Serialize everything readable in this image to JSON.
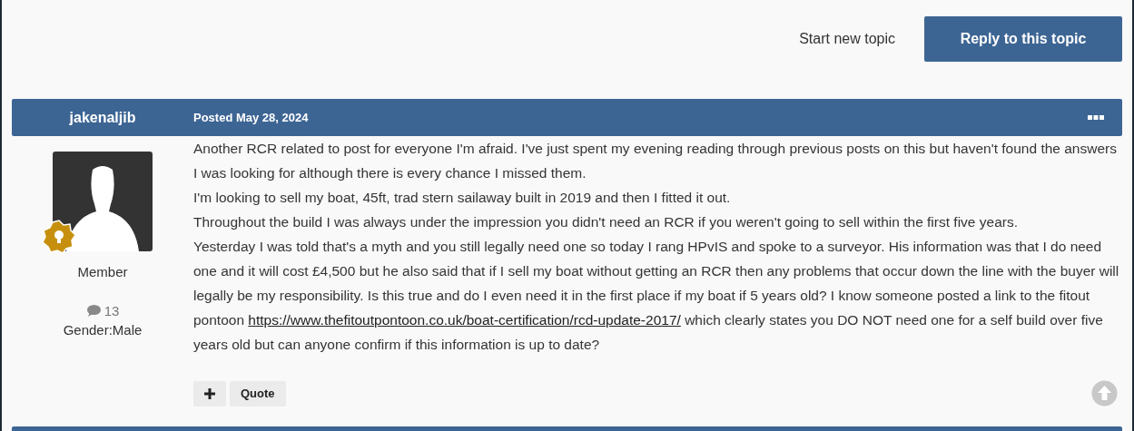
{
  "actions": {
    "start_topic": "Start new topic",
    "reply": "Reply to this topic"
  },
  "post": {
    "author": "jakenaljib",
    "posted_label": "Posted",
    "date": "May 28, 2024",
    "author_info": {
      "rank": "Member",
      "post_count": "13",
      "gender": "Gender:Male"
    },
    "paragraphs": [
      {
        "text": "Another RCR related to post for everyone I'm afraid. I've just spent my evening reading through previous posts on this but haven't found the answers I was looking for although there is every chance I missed them."
      },
      {
        "text": "I'm looking to sell my boat, 45ft, trad stern sailaway built in 2019 and then I fitted it out."
      },
      {
        "text": "Throughout the build I was always under the impression you didn't need an RCR if you weren't going to sell within the first five years."
      },
      {
        "text": "Yesterday I was told that's a myth and you still legally need one so today I rang HPvIS and spoke to a surveyor. His information was that I do need one and it will cost £4,500 but he also said that if I sell my boat without getting an RCR then any problems that occur down the line with the buyer will legally be my responsibility. Is this true and do I even need it in the first place if my boat if 5 years old? I know someone posted a link to the fitout pontoon",
        "link": "https://www.thefitoutpontoon.co.uk/boat-certification/rcd-update-2017/",
        "after": "which clearly states you DO NOT need one for a self build over five years old but can anyone confirm if this information is up to date?"
      }
    ],
    "quote_label": "Quote"
  }
}
